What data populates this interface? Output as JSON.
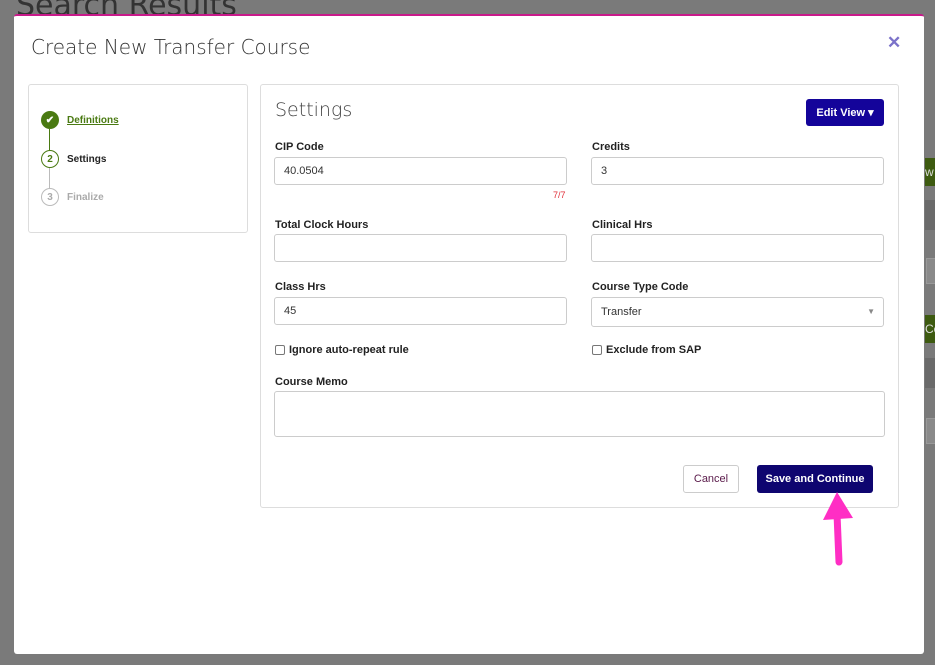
{
  "background": {
    "page_title": "Search Results",
    "fragment_1": "w U",
    "fragment_2": "Cou"
  },
  "modal": {
    "title": "Create New Transfer Course",
    "close_icon": "close-icon"
  },
  "steps": [
    {
      "number": "✔",
      "label": "Definitions",
      "state": "complete"
    },
    {
      "number": "2",
      "label": "Settings",
      "state": "active"
    },
    {
      "number": "3",
      "label": "Finalize",
      "state": "pending"
    }
  ],
  "panel": {
    "title": "Settings",
    "edit_view_label": "Edit View ▾",
    "cip_code": {
      "label": "CIP Code",
      "value": "40.0504",
      "counter": "7/7"
    },
    "credits": {
      "label": "Credits",
      "value": "3"
    },
    "total_clock_hours": {
      "label": "Total Clock Hours",
      "value": ""
    },
    "clinical_hrs": {
      "label": "Clinical Hrs",
      "value": ""
    },
    "class_hrs": {
      "label": "Class Hrs",
      "value": "45"
    },
    "course_type_code": {
      "label": "Course Type Code",
      "value": "Transfer"
    },
    "ignore_auto_repeat": {
      "label": "Ignore auto-repeat rule",
      "checked": false
    },
    "exclude_sap": {
      "label": "Exclude from SAP",
      "checked": false
    },
    "course_memo": {
      "label": "Course Memo",
      "value": ""
    },
    "cancel_label": "Cancel",
    "save_label": "Save and Continue"
  },
  "colors": {
    "accent": "#14049a",
    "save": "#0e0570",
    "success": "#4a7a12",
    "annotation_arrow": "#ff2ec4"
  }
}
